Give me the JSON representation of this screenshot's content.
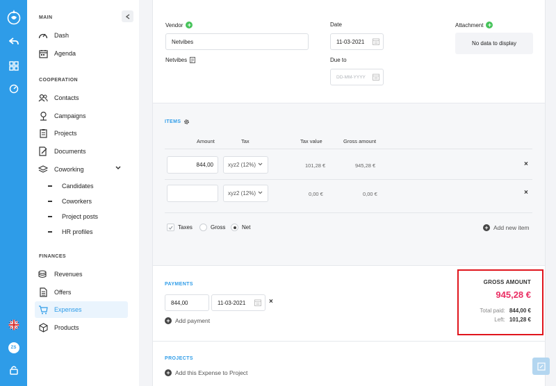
{
  "sidebar": {
    "sections": {
      "main": "MAIN",
      "cooperation": "COOPERATION",
      "finances": "FINANCES"
    },
    "items": {
      "dash": "Dash",
      "agenda": "Agenda",
      "contacts": "Contacts",
      "campaigns": "Campaigns",
      "projects": "Projects",
      "documents": "Documents",
      "coworking": "Coworking",
      "candidates": "Candidates",
      "coworkers": "Coworkers",
      "project_posts": "Project posts",
      "hr_profiles": "HR profiles",
      "revenues": "Revenues",
      "offers": "Offers",
      "expenses": "Expenses",
      "products": "Products"
    },
    "active": "expenses"
  },
  "rail": {
    "avatar_initials": "ZS"
  },
  "form": {
    "vendor_label": "Vendor",
    "vendor_value": "Netvibes",
    "vendor_link": "Netvibes",
    "date_label": "Date",
    "date_value": "11-03-2021",
    "due_label": "Due to",
    "due_placeholder": "DD-MM-YYYY",
    "attachment_label": "Attachment",
    "attachment_empty": "No data to display"
  },
  "items": {
    "title": "ITEMS",
    "columns": {
      "amount": "Amount",
      "tax": "Tax",
      "tax_value": "Tax value",
      "gross_amount": "Gross amount"
    },
    "rows": [
      {
        "amount": "844,00",
        "tax": "xyz2 (12%)",
        "tax_value": "101,28 €",
        "gross": "945,28 €"
      },
      {
        "amount": "",
        "tax": "xyz2 (12%)",
        "tax_value": "0,00 €",
        "gross": "0,00 €"
      }
    ],
    "options": {
      "taxes": "Taxes",
      "gross": "Gross",
      "net": "Net"
    },
    "add_new": "Add new item"
  },
  "payments": {
    "title": "PAYMENTS",
    "amount": "844,00",
    "date": "11-03-2021",
    "add": "Add payment"
  },
  "summary": {
    "title": "GROSS AMOUNT",
    "value": "945,28 €",
    "total_paid_label": "Total paid:",
    "total_paid_value": "844,00 €",
    "left_label": "Left:",
    "left_value": "101,28 €"
  },
  "projects": {
    "title": "PROJECTS",
    "add": "Add this Expense to Project"
  }
}
